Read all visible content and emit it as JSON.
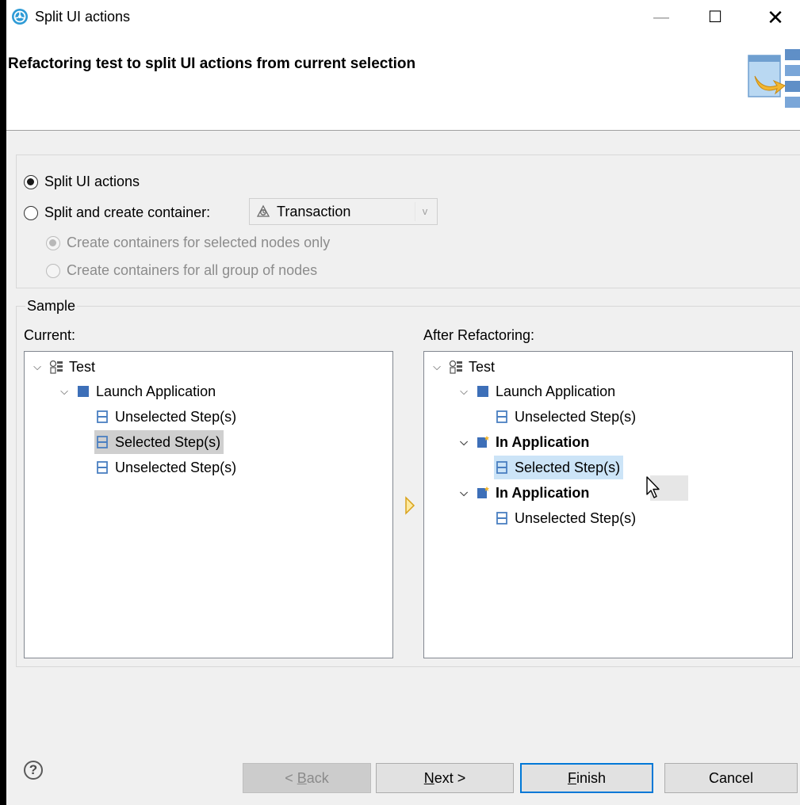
{
  "window": {
    "title": "Split UI actions",
    "minimize_glyph": "—",
    "maximize_glyph": "☐",
    "close_glyph": "✕"
  },
  "header": {
    "title": "Refactoring test to split UI actions from current selection"
  },
  "options": {
    "split_ui_actions": {
      "label": "Split UI actions",
      "checked": true
    },
    "split_and_create": {
      "label": "Split and create container:",
      "checked": false
    },
    "container_combo": {
      "value": "Transaction",
      "arrow": "v"
    },
    "selected_nodes_only": {
      "label": "Create containers for selected nodes only",
      "checked": true,
      "disabled": true
    },
    "all_group_of_nodes": {
      "label": "Create containers for all group of nodes",
      "checked": false,
      "disabled": true
    }
  },
  "sample": {
    "legend": "Sample",
    "current": {
      "label": "Current:",
      "nodes": [
        {
          "text": "Test",
          "icon": "test-icon",
          "expanded": true
        },
        {
          "text": "Launch Application",
          "icon": "container-icon",
          "expanded": true
        },
        {
          "text": "Unselected Step(s)",
          "icon": "step-icon"
        },
        {
          "text": "Selected Step(s)",
          "icon": "step-icon",
          "selected": true
        },
        {
          "text": "Unselected Step(s)",
          "icon": "step-icon"
        }
      ]
    },
    "after": {
      "label": "After Refactoring:",
      "nodes": [
        {
          "text": "Test",
          "icon": "test-icon",
          "expanded": true
        },
        {
          "text": "Launch Application",
          "icon": "container-icon",
          "expanded": true
        },
        {
          "text": "Unselected Step(s)",
          "icon": "step-icon"
        },
        {
          "text": "In Application",
          "icon": "new-container-icon",
          "expanded": true,
          "bold": true
        },
        {
          "text": "Selected Step(s)",
          "icon": "step-icon",
          "selected": true
        },
        {
          "text": "In Application",
          "icon": "new-container-icon",
          "expanded": true,
          "bold": true
        },
        {
          "text": "Unselected Step(s)",
          "icon": "step-icon"
        }
      ]
    }
  },
  "buttons": {
    "help": "?",
    "back_mnemonic": "B",
    "back_rest": "ack",
    "back_prefix": "< ",
    "next_mnemonic": "N",
    "next_rest": "ext >",
    "finish_mnemonic": "F",
    "finish_rest": "inish",
    "cancel": "Cancel"
  },
  "colors": {
    "accent": "#0078d7",
    "selection_blue": "#cce4f7",
    "selection_gray": "#cfcfcf",
    "step_icon": "#4a7fc1",
    "container_icon": "#3d6fb8"
  }
}
